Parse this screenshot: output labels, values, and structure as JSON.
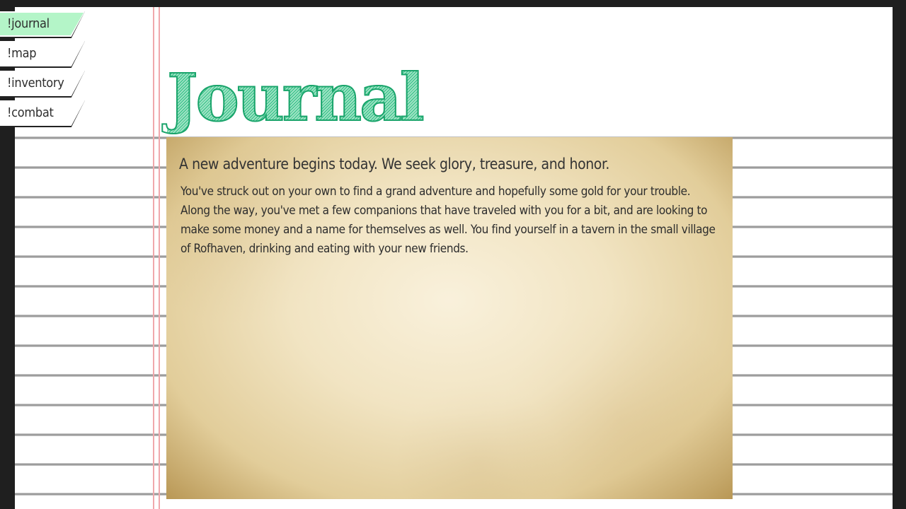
{
  "nav": {
    "tabs": [
      {
        "label": "!journal",
        "active": true
      },
      {
        "label": "!map",
        "active": false
      },
      {
        "label": "!inventory",
        "active": false
      },
      {
        "label": "!combat",
        "active": false
      }
    ]
  },
  "page": {
    "title": "Journal"
  },
  "entry": {
    "heading": "A new adventure begins today. We seek glory, treasure, and honor.",
    "body": "You've struck out on your own to find a grand adventure and hopefully some gold for your trouble. Along the way, you've met a few companions that have traveled with you for a bit, and are looking to make some money and a name for themselves as well. You find yourself in a tavern in the small village of Rofhaven, drinking and eating with your new friends."
  },
  "colors": {
    "active_tab": "#b4f5c8",
    "title_green": "#27b27a",
    "margin_line": "#f0a8ac",
    "frame": "#1f1f1f"
  }
}
